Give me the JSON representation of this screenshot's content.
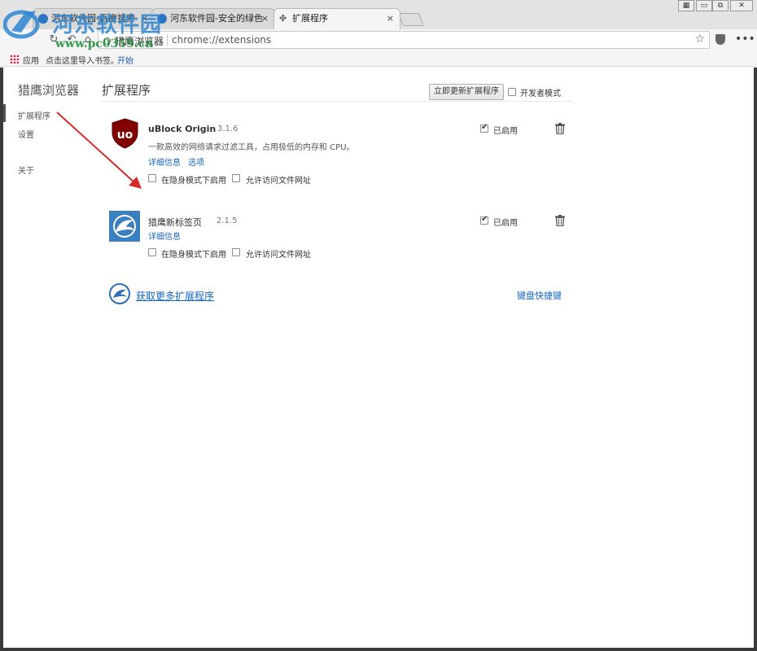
{
  "tabs": [
    {
      "title": "河东软件园-百度搜索",
      "close": "×",
      "active": false
    },
    {
      "title": "河东软件园-安全的绿色",
      "close": "×",
      "active": false
    },
    {
      "title": "扩展程序",
      "close": "×",
      "active": true
    }
  ],
  "window_controls": {
    "minimize": "▭",
    "restore": "⧉",
    "close": "✕",
    "extra": "▦"
  },
  "toolbar": {
    "site_label": "猎鹰浏览器",
    "url": "chrome://extensions",
    "star": "☆",
    "menu": "•••"
  },
  "bookmarks": {
    "apps_label": "应用",
    "hint": "点击这里导入书签。",
    "start_link": "开始"
  },
  "watermark": {
    "text": "河东软件园",
    "url": "www.pc0359.cn"
  },
  "sidebar": {
    "brand": "猎鹰浏览器",
    "items": [
      {
        "label": "扩展程序",
        "active": true
      },
      {
        "label": "设置",
        "active": false
      },
      {
        "label": "关于",
        "active": false
      }
    ]
  },
  "header": {
    "title": "扩展程序",
    "update_button": "立即更新扩展程序",
    "dev_mode_label": "开发者模式",
    "dev_mode_checked": false
  },
  "extensions": [
    {
      "name": "uBlock Origin",
      "version": "3.1.6",
      "description": "一款高效的网络请求过滤工具，占用极低的内存和 CPU。",
      "details_link": "详细信息",
      "options_link": "选项",
      "enabled_label": "已启用",
      "enabled": true,
      "incognito_label": "在隐身模式下启用",
      "file_access_label": "允许访问文件网址",
      "icon": "ublock-shield-icon"
    },
    {
      "name": "猎鹰新标签页",
      "version": "2.1.5",
      "details_link": "详细信息",
      "enabled_label": "已启用",
      "enabled": true,
      "incognito_label": "在隐身模式下启用",
      "file_access_label": "允许访问文件网址",
      "icon": "falcon-icon"
    }
  ],
  "footer": {
    "get_more_link": "获取更多扩展程序",
    "keyboard_shortcuts_link": "键盘快捷键"
  },
  "colors": {
    "link": "#1565c0",
    "ublock_red": "#800000",
    "falcon_blue": "#3a7fbf",
    "annotation_arrow": "#d42a2a"
  }
}
